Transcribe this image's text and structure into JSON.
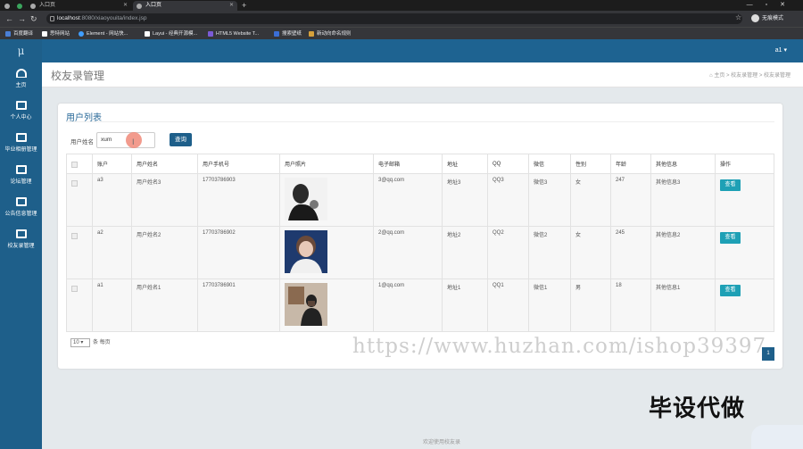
{
  "browser": {
    "tabs": [
      {
        "label": "入口页",
        "active": false
      },
      {
        "label": "入口页",
        "active": true
      }
    ],
    "new_tab": "+",
    "window_controls": [
      "—",
      "▫",
      "✕"
    ],
    "url_host": "localhost",
    "url_rest": ":8080/xiaoyouita/index.jsp",
    "profile_label": "无痕模式",
    "bookmarks": [
      {
        "label": "百度翻译",
        "color": "#4a7fd6"
      },
      {
        "label": "思特网站",
        "color": "#ffffff"
      },
      {
        "label": "Element - 网站快...",
        "color": "#409eff"
      },
      {
        "label": "Layui - 经典开源模...",
        "color": "#ffffff"
      },
      {
        "label": "HTML5 Website T...",
        "color": "#7b5bd6"
      },
      {
        "label": "搜索壁纸",
        "color": "#3b6ed6"
      },
      {
        "label": "新动向命名规则",
        "color": "#d6a13b"
      }
    ]
  },
  "sidebar": {
    "logo": "μ",
    "items": [
      {
        "label": "主页",
        "icon": "dashboard-icon"
      },
      {
        "label": "个人中心",
        "icon": "monitor-icon"
      },
      {
        "label": "毕业相册管理",
        "icon": "monitor-icon"
      },
      {
        "label": "论坛管理",
        "icon": "monitor-icon"
      },
      {
        "label": "公告信息管理",
        "icon": "monitor-icon"
      },
      {
        "label": "校友录管理",
        "icon": "monitor-icon"
      }
    ]
  },
  "topbar": {
    "user": "a1 ▾"
  },
  "breadcrumb": {
    "page_title": "校友录管理",
    "trail": "⌂ 主页  >  校友录管理  >  校友录管理"
  },
  "panel": {
    "title": "用户列表",
    "search_label": "用户姓名",
    "search_value": "xum",
    "search_button": "查询",
    "columns": [
      "",
      "账户",
      "用户姓名",
      "用户手机号",
      "用户照片",
      "电子邮箱",
      "地址",
      "QQ",
      "微信",
      "性别",
      "年龄",
      "其他信息",
      "操作"
    ],
    "rows": [
      {
        "account": "a3",
        "name": "用户姓名3",
        "phone": "17703786903",
        "email": "3@qq.com",
        "address": "地址3",
        "qq": "QQ3",
        "wechat": "微信3",
        "gender": "女",
        "age": "247",
        "other": "其他信息3",
        "action": "查看",
        "photo_colors": [
          "#2a2a2a",
          "#f5f5f5",
          "#777777"
        ]
      },
      {
        "account": "a2",
        "name": "用户姓名2",
        "phone": "17703786902",
        "email": "2@qq.com",
        "address": "地址2",
        "qq": "QQ2",
        "wechat": "微信2",
        "gender": "女",
        "age": "245",
        "other": "其他信息2",
        "action": "查看",
        "photo_colors": [
          "#1e3a6e",
          "#e8c9b8",
          "#6a4a3a"
        ]
      },
      {
        "account": "a1",
        "name": "用户姓名1",
        "phone": "17703786901",
        "email": "1@qq.com",
        "address": "地址1",
        "qq": "QQ1",
        "wechat": "微信1",
        "gender": "男",
        "age": "18",
        "other": "其他信息1",
        "action": "查看",
        "photo_colors": [
          "#c7b8a8",
          "#5a4438",
          "#222222"
        ]
      }
    ],
    "page_size": "10",
    "page_size_suffix": "条 每页",
    "current_page": "1"
  },
  "overlay": {
    "watermark": "https://www.huzhan.com/ishop39397",
    "promo": "毕设代做"
  },
  "footer": "欢迎使用校友录"
}
